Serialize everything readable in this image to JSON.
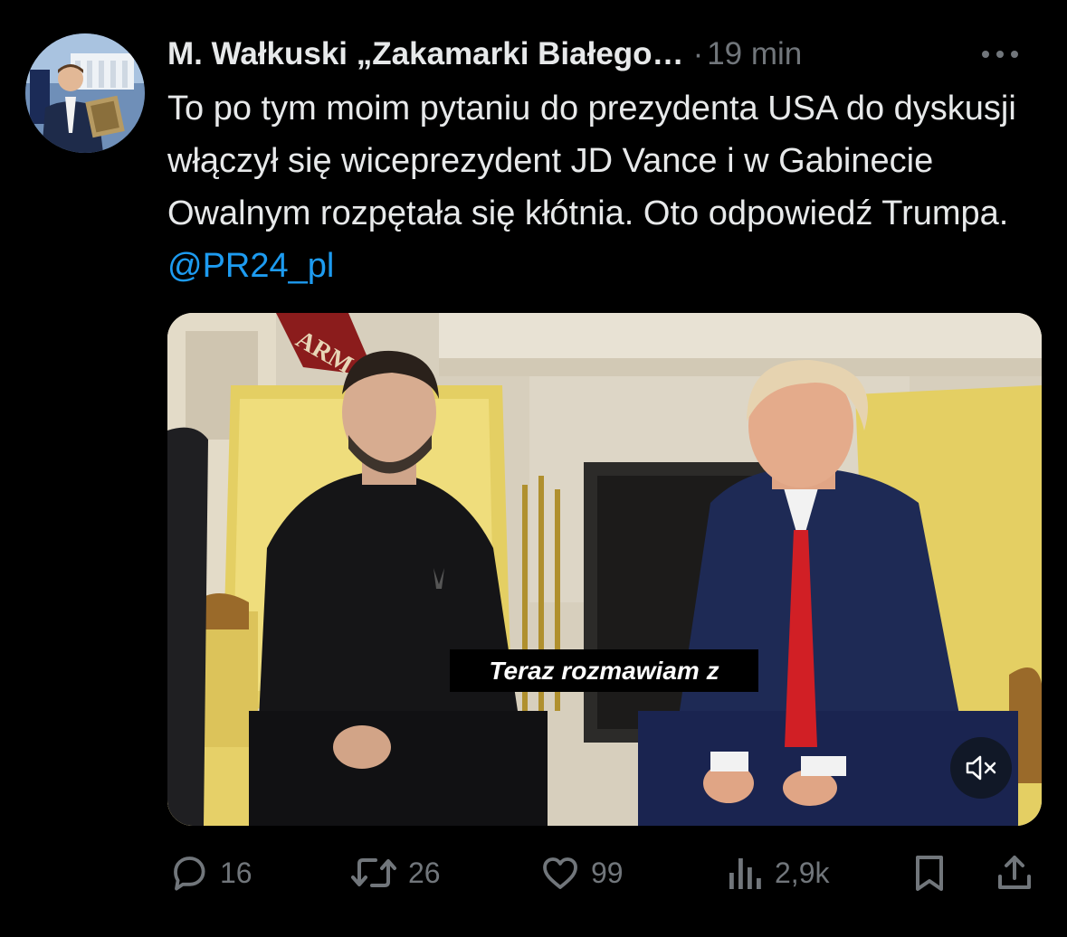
{
  "author": {
    "name": "M. Wałkuski „Zakamarki Białego…",
    "separator": "·",
    "time": "19 min"
  },
  "tweet": {
    "text": "To po tym moim pytaniu do prezydenta USA do dyskusji włączył się wiceprezydent JD Vance i w Gabinecie Owalnym rozpętała się kłótnia. Oto odpowiedź Trumpa. ",
    "mention": "@PR24_pl"
  },
  "media": {
    "caption": "Teraz rozmawiam z",
    "sign_text": "ARM"
  },
  "actions": {
    "replies": "16",
    "reposts": "26",
    "likes": "99",
    "views": "2,9k"
  },
  "icons": {
    "more": "more-icon",
    "reply": "reply-icon",
    "repost": "repost-icon",
    "like": "heart-icon",
    "views": "views-icon",
    "bookmark": "bookmark-icon",
    "share": "share-icon",
    "mute": "mute-icon"
  },
  "colors": {
    "background": "#000000",
    "text": "#e7e9ea",
    "muted": "#71767b",
    "link": "#1d9bf0"
  }
}
